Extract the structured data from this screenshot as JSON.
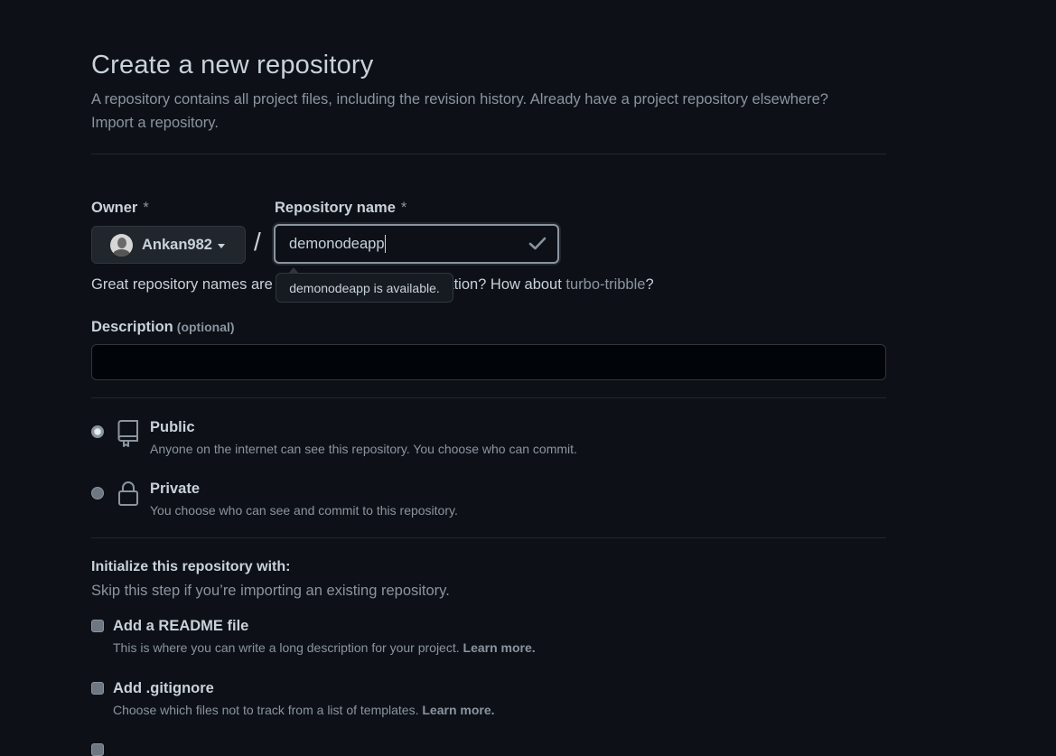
{
  "header": {
    "title": "Create a new repository",
    "subtitle_text": "A repository contains all project files, including the revision history. Already have a project repository elsewhere?",
    "import_link": "Import a repository."
  },
  "owner": {
    "label": "Owner",
    "required_mark": "*",
    "name": "Ankan982",
    "avatar_icon": "user-avatar"
  },
  "repo_name": {
    "label": "Repository name",
    "required_mark": "*",
    "value": "demonodeapp",
    "separator": "/",
    "valid_icon": "check-icon"
  },
  "hint": {
    "text_before": "Great repository names are",
    "text_after": "eed inspiration? How about",
    "suggestion": "turbo-tribble",
    "end": "?"
  },
  "tooltip": {
    "text": "demonodeapp is available."
  },
  "description": {
    "label": "Description",
    "optional": "(optional)",
    "value": ""
  },
  "visibility": [
    {
      "title": "Public",
      "subtitle": "Anyone on the internet can see this repository. You choose who can commit.",
      "selected": true,
      "icon": "repo-icon"
    },
    {
      "title": "Private",
      "subtitle": "You choose who can see and commit to this repository.",
      "selected": false,
      "icon": "lock-icon"
    }
  ],
  "initialize": {
    "title": "Initialize this repository with:",
    "subtitle": "Skip this step if you’re importing an existing repository.",
    "options": [
      {
        "title": "Add a README file",
        "subtitle": "This is where you can write a long description for your project.",
        "link": "Learn more.",
        "checked": false
      },
      {
        "title": "Add .gitignore",
        "subtitle": "Choose which files not to track from a list of templates.",
        "link": "Learn more.",
        "checked": false
      }
    ]
  },
  "colors": {
    "background": "#0d1117",
    "text": "#c9d1d9",
    "muted": "#8b949e",
    "border": "#30363d"
  }
}
